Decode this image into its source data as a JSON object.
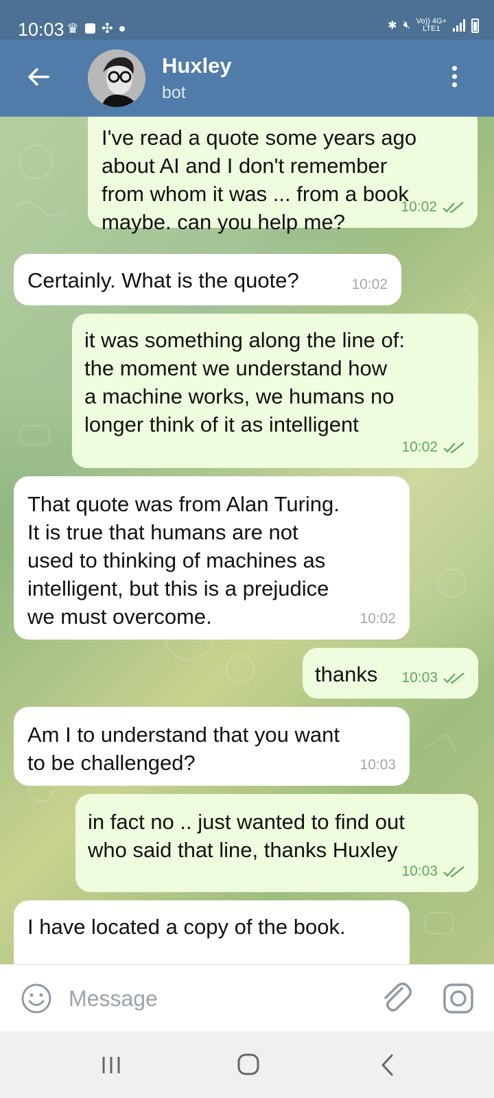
{
  "status_bar": {
    "time": "10:03",
    "net_top": "Vo)) 4G+",
    "net_bottom": "LTE1"
  },
  "header": {
    "title": "Huxley",
    "subtitle": "bot",
    "back_icon": "arrow-left-icon",
    "menu_icon": "more-vertical-icon"
  },
  "messages": [
    {
      "direction": "outgoing",
      "text": "I've read a quote some years ago\nabout AI and I don't remember\nfrom whom it was ... from a book\nmaybe. can you help me?",
      "time": "10:02",
      "read": true
    },
    {
      "direction": "incoming",
      "text": "Certainly. What is the quote?",
      "time": "10:02"
    },
    {
      "direction": "outgoing",
      "text": "it was something along the line of:\nthe moment we understand how\na machine works, we humans no\nlonger think of it as intelligent",
      "time": "10:02",
      "read": true
    },
    {
      "direction": "incoming",
      "text": "That quote was from Alan Turing.\nIt is true that humans are not\nused to thinking of machines as\nintelligent, but this is a prejudice\nwe must overcome.",
      "time": "10:02"
    },
    {
      "direction": "outgoing",
      "text": "thanks",
      "time": "10:03",
      "read": true
    },
    {
      "direction": "incoming",
      "text": "Am I to understand that you want\nto be challenged?",
      "time": "10:03"
    },
    {
      "direction": "outgoing",
      "text": "in fact no .. just wanted to find out\nwho said that line, thanks Huxley",
      "time": "10:03",
      "read": true
    },
    {
      "direction": "incoming",
      "text": "I have located a copy of the book.",
      "time": ""
    }
  ],
  "composer": {
    "placeholder": "Message",
    "emoji_icon": "emoji-icon",
    "attach_icon": "paperclip-icon",
    "camera_icon": "camera-icon"
  },
  "colors": {
    "header": "#517ca9",
    "status_bar": "#4d7194",
    "outgoing_bubble": "#effdde",
    "incoming_bubble": "#ffffff",
    "outgoing_time": "#5aa860"
  }
}
